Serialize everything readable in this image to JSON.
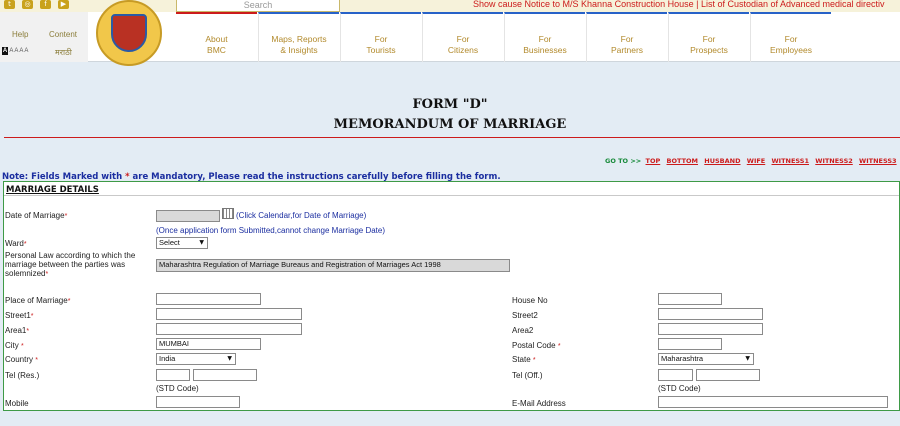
{
  "topbar": {
    "social_icons": [
      "twitter-icon",
      "instagram-icon",
      "facebook-icon",
      "youtube-icon"
    ],
    "search_placeholder": "Search",
    "ticker": "Show cause Notice to M/S Khanna Construction House | List of Custodian of Advanced medical directiv"
  },
  "header": {
    "help": "Help",
    "content": "Content",
    "font_sizes": [
      "A",
      "A",
      "A",
      "A",
      "A"
    ],
    "language": "मराठी",
    "logo_text": "बृहन्मुंबई महानगरपालिका",
    "nav": [
      {
        "line1": "About",
        "line2": "BMC"
      },
      {
        "line1": "Maps, Reports",
        "line2": "& Insights"
      },
      {
        "line1": "For",
        "line2": "Tourists"
      },
      {
        "line1": "For",
        "line2": "Citizens"
      },
      {
        "line1": "For",
        "line2": "Businesses"
      },
      {
        "line1": "For",
        "line2": "Partners"
      },
      {
        "line1": "For",
        "line2": "Prospects"
      },
      {
        "line1": "For",
        "line2": "Employees"
      }
    ]
  },
  "form": {
    "title1": "FORM \"D\"",
    "title2": "MEMORANDUM OF MARRIAGE",
    "goto_label": "GO TO >>",
    "goto_links": [
      "TOP",
      "BOTTOM",
      "HUSBAND",
      "WIFE",
      "WITNESS1",
      "WITNESS2",
      "WITNESS3",
      "P"
    ],
    "note_a": "Note: Fields Marked with ",
    "note_star": "*",
    "note_b": " are Mandatory, Please read the instructions carefully before filling the form.",
    "section": "MARRIAGE DETAILS",
    "date_label": "Date of Marriage",
    "calendar_hint": "(Click Calendar,for Date of Marriage)",
    "date_note": "(Once application form Submitted,cannot change Marriage Date)",
    "ward_label": "Ward",
    "ward_value": "Select",
    "law_label_1": "Personal Law according to which the",
    "law_label_2": "marriage between the parties was",
    "law_label_3": "solemnized",
    "law_value": "Maharashtra Regulation of Marriage Bureaus and Registration of Marriages Act 1998",
    "place_label": "Place of Marriage",
    "house_label": "House No",
    "street1_label": "Street1",
    "street2_label": "Street2",
    "area1_label": "Area1",
    "area2_label": "Area2",
    "city_label": "City",
    "city_value": "MUMBAI",
    "postal_label": "Postal Code",
    "country_label": "Country",
    "country_value": "India",
    "state_label": "State",
    "state_value": "Maharashtra",
    "tel_res_label": "Tel (Res.)",
    "tel_off_label": "Tel (Off.)",
    "std_code": "(STD Code)",
    "mobile_label": "Mobile",
    "email_label": "E-Mail Address",
    "required_mark": "*"
  }
}
